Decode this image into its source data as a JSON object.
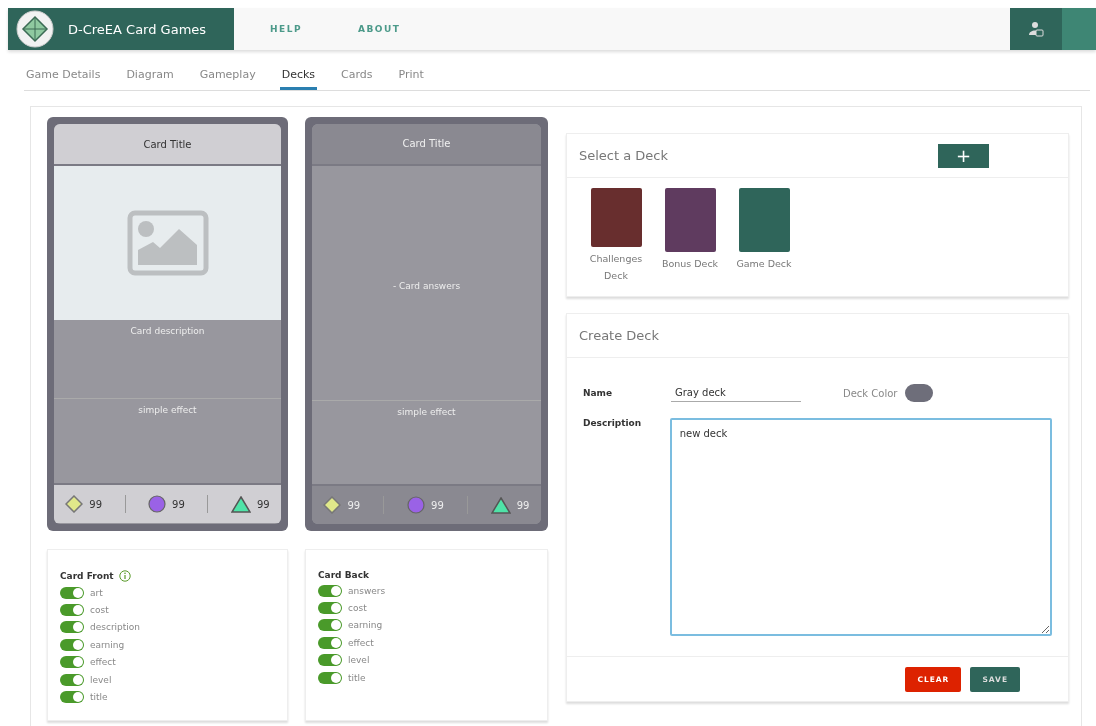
{
  "header": {
    "title": "D-CreEA Card Games",
    "nav": [
      "HELP",
      "ABOUT"
    ]
  },
  "tabs": [
    {
      "label": "Game Details",
      "selected": false
    },
    {
      "label": "Diagram",
      "selected": false
    },
    {
      "label": "Gameplay",
      "selected": false
    },
    {
      "label": "Decks",
      "selected": true
    },
    {
      "label": "Cards",
      "selected": false
    },
    {
      "label": "Print",
      "selected": false
    }
  ],
  "cards": [
    {
      "kind": "front",
      "title": "Card Title",
      "description": "Card description",
      "effect": "simple effect",
      "stats": [
        {
          "kind": "diamond",
          "value": "99"
        },
        {
          "kind": "circle",
          "value": "99"
        },
        {
          "kind": "triangle",
          "value": "99"
        }
      ]
    },
    {
      "kind": "back",
      "title": "Card Title",
      "answers": "- Card answers",
      "effect": "simple effect",
      "stats": [
        {
          "kind": "diamond",
          "value": "99"
        },
        {
          "kind": "circle",
          "value": "99"
        },
        {
          "kind": "triangle",
          "value": "99"
        }
      ]
    }
  ],
  "toggle_panels": [
    {
      "title": "Card Front",
      "info": true,
      "items": [
        {
          "label": "art",
          "on": true
        },
        {
          "label": "cost",
          "on": true
        },
        {
          "label": "description",
          "on": true
        },
        {
          "label": "earning",
          "on": true
        },
        {
          "label": "effect",
          "on": true
        },
        {
          "label": "level",
          "on": true
        },
        {
          "label": "title",
          "on": true
        }
      ]
    },
    {
      "title": "Card Back",
      "info": false,
      "items": [
        {
          "label": "answers",
          "on": true
        },
        {
          "label": "cost",
          "on": true
        },
        {
          "label": "earning",
          "on": true
        },
        {
          "label": "effect",
          "on": true
        },
        {
          "label": "level",
          "on": true
        },
        {
          "label": "title",
          "on": true
        }
      ]
    }
  ],
  "select_deck": {
    "title": "Select a Deck",
    "add_button": "+",
    "decks": [
      {
        "name": "Challenges Deck",
        "color": "#682e2e"
      },
      {
        "name": "Bonus Deck",
        "color": "#5f3b5f"
      },
      {
        "name": "Game Deck",
        "color": "#2f655a"
      }
    ]
  },
  "create_deck": {
    "title": "Create Deck",
    "name_label": "Name",
    "name_value": "Gray deck",
    "color_label": "Deck Color",
    "color": "#6e6e7a",
    "description_label": "Description",
    "description_value": "new deck",
    "buttons": [
      {
        "label": "CLEAR",
        "kind": "danger"
      },
      {
        "label": "SAVE",
        "kind": "primary"
      }
    ]
  }
}
